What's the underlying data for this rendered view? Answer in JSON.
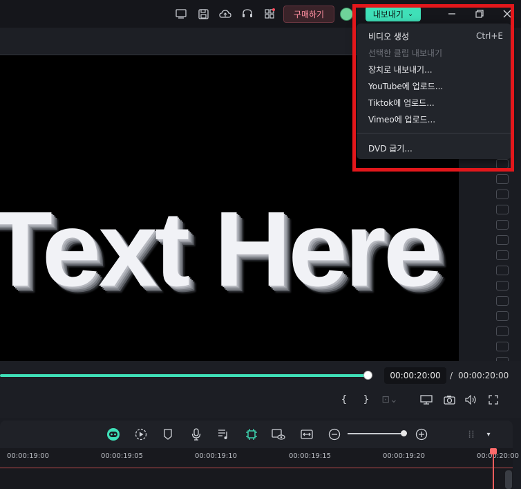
{
  "titlebar": {
    "purchase_label": "구매하기",
    "export_label": "내보내기",
    "icons": [
      "monitor-icon",
      "save-icon",
      "cloud-upload-icon",
      "headset-icon",
      "grid-icon"
    ]
  },
  "preview": {
    "text": "Text Here"
  },
  "export_menu": {
    "items": [
      {
        "label": "비디오 생성",
        "shortcut": "Ctrl+E",
        "disabled": false
      },
      {
        "label": "선택한 클립 내보내기",
        "shortcut": "",
        "disabled": true
      },
      {
        "label": "장치로 내보내기...",
        "shortcut": "",
        "disabled": false
      },
      {
        "label": "YouTube에 업로드...",
        "shortcut": "",
        "disabled": false
      },
      {
        "label": "Tiktok에 업로드...",
        "shortcut": "",
        "disabled": false
      },
      {
        "label": "Vimeo에 업로드...",
        "shortcut": "",
        "disabled": false
      },
      {
        "label": "DVD 굽기...",
        "shortcut": "",
        "disabled": false
      }
    ]
  },
  "playback": {
    "progress": 1.0,
    "current_time": "00:00:20:00",
    "separator": "/",
    "total_time": "00:00:20:00"
  },
  "timeline": {
    "ticks": [
      "00:00:19:00",
      "00:00:19:05",
      "00:00:19:10",
      "00:00:19:15",
      "00:00:19:20",
      "00:00:20:00"
    ]
  },
  "colors": {
    "accent": "#3fe0b8",
    "highlight": "#e3171b",
    "playhead": "#ff5c5c"
  }
}
